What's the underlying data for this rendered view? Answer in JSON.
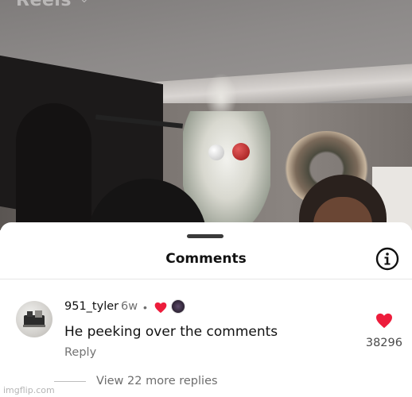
{
  "header": {
    "section_label": "Reels"
  },
  "comments_sheet": {
    "title": "Comments",
    "info_icon": "info-circle-icon",
    "comment": {
      "username": "951_tyler",
      "time_ago": "6w",
      "separator": "•",
      "text": "He peeking over the comments",
      "reply_label": "Reply",
      "like_count": "38296",
      "like_color": "#ed1c3b"
    },
    "view_replies_label": "View 22 more replies"
  },
  "watermark": "imgflip.com"
}
